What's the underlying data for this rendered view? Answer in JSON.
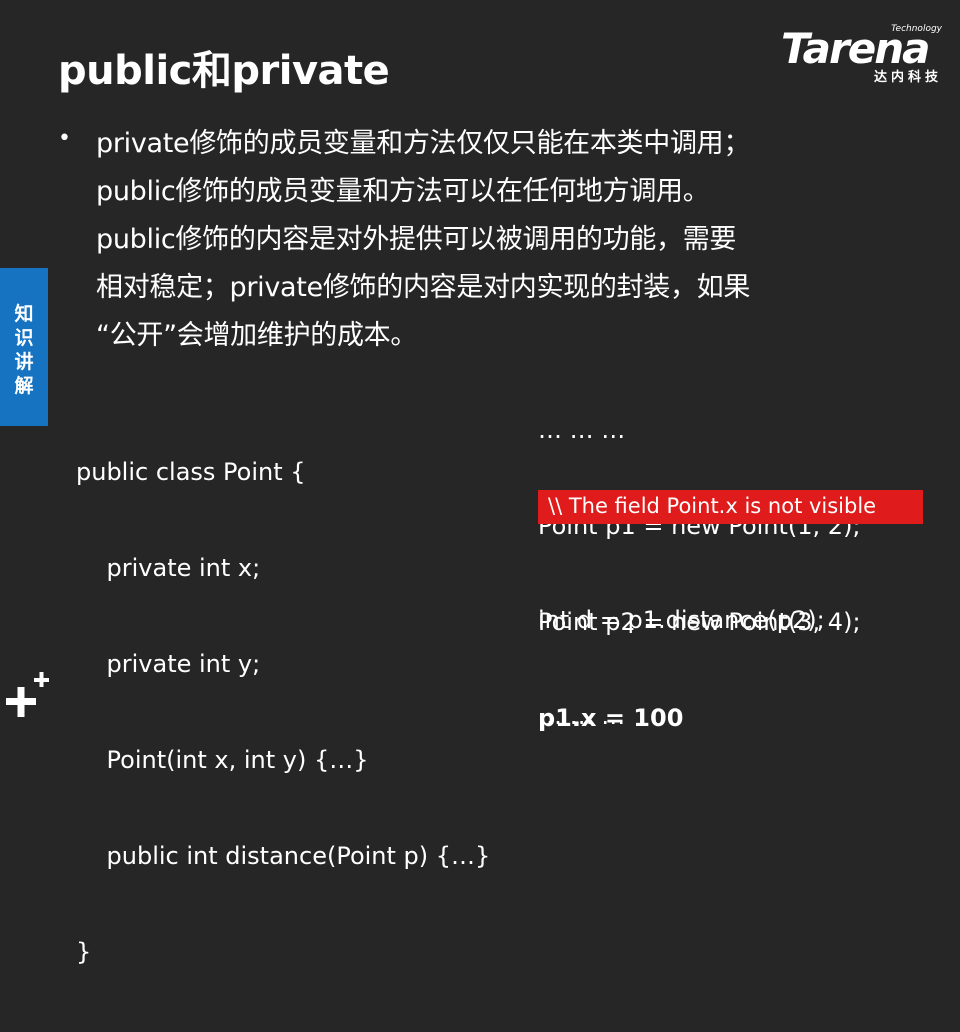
{
  "title": "public和private",
  "logo": {
    "technology": "Technology",
    "brand": "Tarena",
    "brand_cn": "达内科技"
  },
  "side_tab": {
    "label": "知识讲解"
  },
  "bullet": {
    "lines": [
      "private修饰的成员变量和方法仅仅只能在本类中调用；",
      "public修饰的成员变量和方法可以在任何地方调用。",
      "public修饰的内容是对外提供可以被调用的功能，需要",
      "相对稳定；private修饰的内容是对内实现的封装，如果",
      "“公开”会增加维护的成本。"
    ]
  },
  "code_left": {
    "lines": [
      "public class Point {",
      "    private int x;",
      "    private int y;",
      "    Point(int x, int y) {…}",
      "    public int distance(Point p) {…}",
      "}"
    ]
  },
  "code_right": {
    "lines": [
      "… … …",
      "Point p1 = new Point(1, 2);",
      "Point p2 = new Point(3, 4);"
    ],
    "bold_line": "p1.x = 100",
    "error": "\\\\ The field Point.x is not visible",
    "after_lines": [
      "int d = p1.distance(p2);",
      "… … …"
    ]
  },
  "colors": {
    "background": "#262626",
    "side_tab": "#1573c2",
    "error": "#e01b1b"
  },
  "icons": [
    "plus-icon"
  ]
}
